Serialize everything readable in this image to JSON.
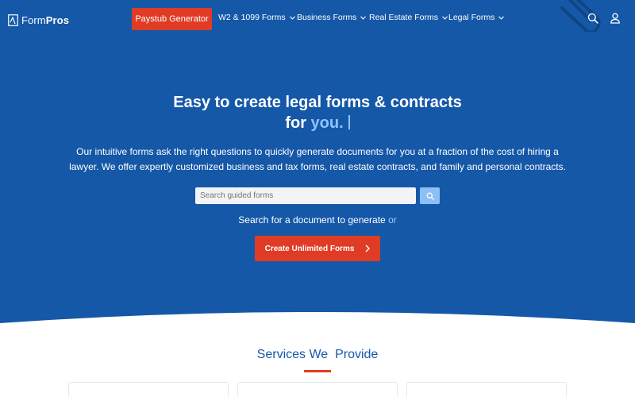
{
  "brand": {
    "name_part1": "Form",
    "name_part2": "Pros"
  },
  "nav": {
    "cta_label": "Paystub Generator",
    "items": [
      {
        "label": "W2 & 1099 Forms"
      },
      {
        "label": "Business Forms"
      },
      {
        "label": "Real Estate Forms"
      },
      {
        "label": "Legal Forms"
      }
    ],
    "icons": [
      "search-icon",
      "user-icon"
    ]
  },
  "hero": {
    "headline_line1": "Easy to create legal forms & contracts",
    "headline_line2_prefix": "for",
    "headline_line2_accent": "you.",
    "lede": "Our intuitive forms ask the right questions to quickly generate documents for you at a fraction of the cost of hiring a lawyer. We offer expertly customized business and tax forms, real estate contracts, and family and personal contracts.",
    "search_placeholder": "Search guided forms",
    "helper_text": "Search for a document to generate",
    "helper_or": "or",
    "cta_label": "Create Unlimited Forms"
  },
  "services": {
    "title": "Services We  Provide"
  },
  "colors": {
    "primary": "#1558a8",
    "accent": "#e03c25",
    "light_accent": "#8fc4ff"
  }
}
